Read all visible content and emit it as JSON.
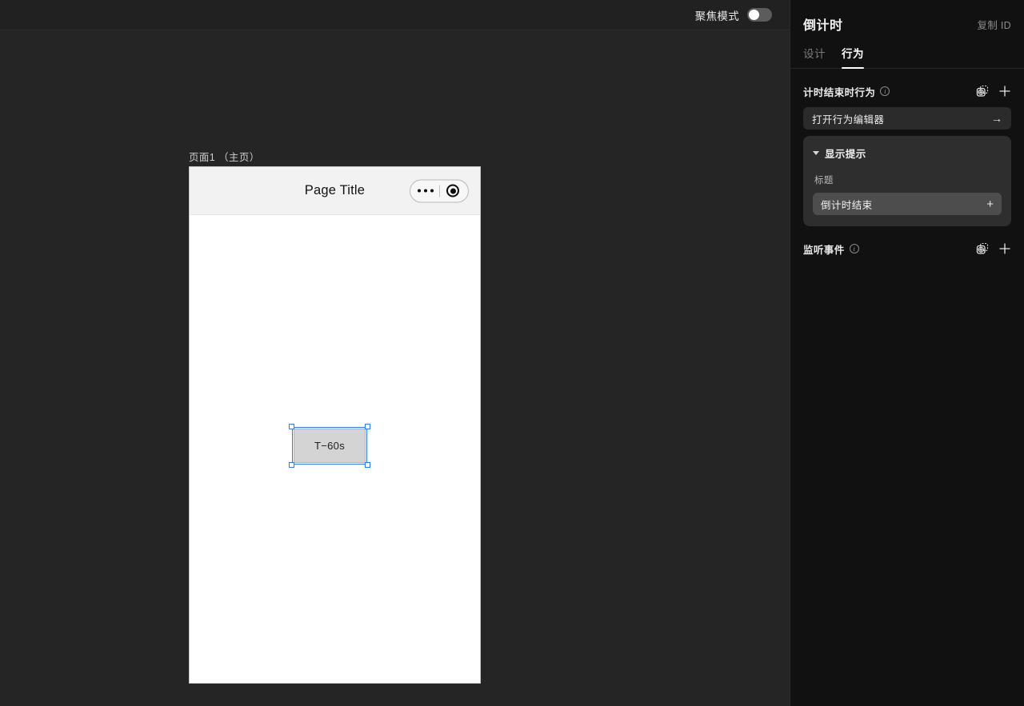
{
  "canvas": {
    "focus_mode": {
      "label": "聚焦模式",
      "enabled": false
    },
    "page_label": "页面1 （主页）",
    "phone": {
      "nav_title": "Page Title",
      "capsule": {
        "more_icon": "more-dots-icon",
        "target_icon": "target-circle-icon"
      },
      "selected_element": {
        "text": "T−60s"
      }
    }
  },
  "panel": {
    "title": "倒计时",
    "copy_id": "复制 ID",
    "tabs": [
      {
        "label": "设计",
        "active": false
      },
      {
        "label": "行为",
        "active": true
      }
    ],
    "sections": [
      {
        "title": "计时结束时行为",
        "info_icon": "info-circle-icon",
        "actions": [
          "add-from-library-icon",
          "plus-icon"
        ],
        "open_editor": {
          "label": "打开行为编辑器",
          "arrow": "→"
        },
        "card": {
          "title": "显示提示",
          "expanded": true,
          "field_label": "标题",
          "field_value": "倒计时结束",
          "field_action": "+"
        }
      },
      {
        "title": "监听事件",
        "info_icon": "info-circle-icon",
        "actions": [
          "add-from-library-icon",
          "plus-icon"
        ]
      }
    ]
  },
  "colors": {
    "canvas_bg": "#252525",
    "panel_bg": "#111111",
    "accent_selection": "#2b7cf0",
    "card_bg": "#2e2e2e",
    "field_bg": "#4d4d4d"
  }
}
